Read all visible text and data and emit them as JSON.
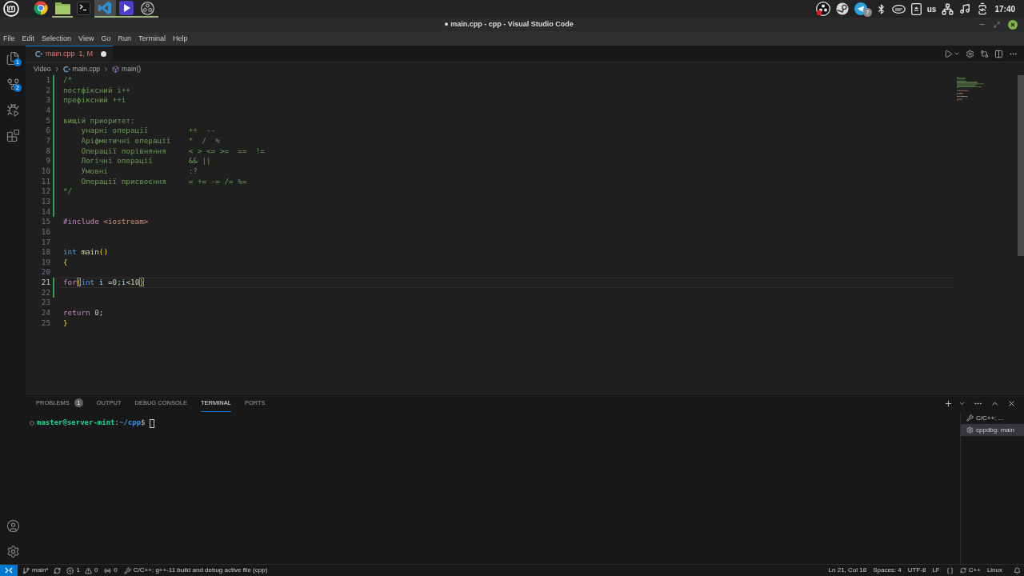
{
  "taskbar": {
    "apps": [
      {
        "kind": "browser",
        "running": false,
        "selected": false
      },
      {
        "kind": "files",
        "running": true,
        "selected": false
      },
      {
        "kind": "terminal",
        "running": false,
        "selected": false
      },
      {
        "kind": "code",
        "running": true,
        "selected": true
      },
      {
        "kind": "player",
        "running": true,
        "selected": false
      },
      {
        "kind": "recorder",
        "running": true,
        "selected": false
      }
    ],
    "tray": {
      "badge": "7",
      "keyboard_layout": "us",
      "clock": "17:40"
    }
  },
  "window": {
    "title": "● main.cpp - cpp - Visual Studio Code"
  },
  "menu": [
    "File",
    "Edit",
    "Selection",
    "View",
    "Go",
    "Run",
    "Terminal",
    "Help"
  ],
  "activity_bar": {
    "explorer_badge": "1",
    "source_control_badge": "2"
  },
  "tabs": [
    {
      "label": "main.cpp",
      "status": "1, M",
      "dirty": true,
      "selected": true
    }
  ],
  "breadcrumb": {
    "folder": "Video",
    "file": "main.cpp",
    "symbol": "main()"
  },
  "editor": {
    "lines": [
      {
        "number": "1",
        "added": true,
        "current": false,
        "tokens": [
          {
            "kind": "comment",
            "text": "/*"
          }
        ]
      },
      {
        "number": "2",
        "added": true,
        "current": false,
        "tokens": [
          {
            "kind": "comment",
            "text": "постфіксний i++"
          }
        ]
      },
      {
        "number": "3",
        "added": true,
        "current": false,
        "tokens": [
          {
            "kind": "comment",
            "text": "префіксний ++i"
          }
        ]
      },
      {
        "number": "4",
        "added": true,
        "current": false
      },
      {
        "number": "5",
        "added": true,
        "current": false,
        "tokens": [
          {
            "kind": "comment",
            "text": "вищій приоритет:"
          }
        ]
      },
      {
        "number": "6",
        "added": true,
        "current": false,
        "tokens": [
          {
            "kind": "comment",
            "text": "    унарні операції         ++  --"
          }
        ]
      },
      {
        "number": "7",
        "added": true,
        "current": false,
        "tokens": [
          {
            "kind": "comment",
            "text": "    Аріфметичні операції    *  /  %"
          }
        ]
      },
      {
        "number": "8",
        "added": true,
        "current": false,
        "tokens": [
          {
            "kind": "comment",
            "text": "    Операції порівняння     < > <= >=  ==  !="
          }
        ]
      },
      {
        "number": "9",
        "added": true,
        "current": false,
        "tokens": [
          {
            "kind": "comment",
            "text": "    Логічні операції        && ||"
          }
        ]
      },
      {
        "number": "10",
        "added": true,
        "current": false,
        "tokens": [
          {
            "kind": "comment",
            "text": "    Умовні                  :?"
          }
        ]
      },
      {
        "number": "11",
        "added": true,
        "current": false,
        "tokens": [
          {
            "kind": "comment",
            "text": "    Операції присвоєння     = += -= /= %="
          }
        ]
      },
      {
        "number": "12",
        "added": true,
        "current": false,
        "tokens": [
          {
            "kind": "comment",
            "text": "*/"
          }
        ]
      },
      {
        "number": "13",
        "added": true,
        "current": false
      },
      {
        "number": "14",
        "added": true,
        "current": false
      },
      {
        "number": "15",
        "added": false,
        "current": false,
        "tokens": [
          {
            "kind": "keyword",
            "text": "#include "
          },
          {
            "kind": "string",
            "text": "<iostream>"
          }
        ]
      },
      {
        "number": "16",
        "added": false,
        "current": false
      },
      {
        "number": "17",
        "added": false,
        "current": false
      },
      {
        "number": "18",
        "added": false,
        "current": false,
        "tokens": [
          {
            "kind": "type",
            "text": "int "
          },
          {
            "kind": "function",
            "text": "main"
          },
          {
            "kind": "bracket",
            "text": "()"
          }
        ]
      },
      {
        "number": "19",
        "added": false,
        "current": false,
        "tokens": [
          {
            "kind": "bracket",
            "text": "{"
          }
        ]
      },
      {
        "number": "20",
        "added": false,
        "current": false
      },
      {
        "number": "21",
        "added": true,
        "current": true,
        "tokens": [
          {
            "kind": "keyword",
            "text": "for"
          },
          {
            "kind": "bracket_match",
            "text": "("
          },
          {
            "kind": "type",
            "text": "int "
          },
          {
            "kind": "variable",
            "text": "i"
          },
          {
            "kind": "plain",
            "text": " ="
          },
          {
            "kind": "number",
            "text": "0"
          },
          {
            "kind": "plain",
            "text": ";"
          },
          {
            "kind": "variable",
            "text": "i"
          },
          {
            "kind": "plain",
            "text": "<"
          },
          {
            "kind": "number",
            "text": "10"
          },
          {
            "kind": "bracket_match",
            "text": ")"
          }
        ]
      },
      {
        "number": "22",
        "added": true,
        "current": false
      },
      {
        "number": "23",
        "added": false,
        "current": false
      },
      {
        "number": "24",
        "added": false,
        "current": false,
        "tokens": [
          {
            "kind": "keyword",
            "text": "return "
          },
          {
            "kind": "number",
            "text": "0"
          },
          {
            "kind": "plain",
            "text": ";"
          }
        ]
      },
      {
        "number": "25",
        "added": false,
        "current": false,
        "tokens": [
          {
            "kind": "bracket",
            "text": "}"
          }
        ]
      }
    ]
  },
  "panel": {
    "tabs": [
      {
        "label": "PROBLEMS",
        "badge": "1",
        "selected": false
      },
      {
        "label": "OUTPUT",
        "selected": false
      },
      {
        "label": "DEBUG CONSOLE",
        "selected": false
      },
      {
        "label": "TERMINAL",
        "selected": true
      },
      {
        "label": "PORTS",
        "selected": false
      }
    ],
    "terminal": {
      "prompt": [
        {
          "kind": "user",
          "text": "master@server-mint"
        },
        {
          "kind": "plain",
          "text": ":"
        },
        {
          "kind": "path",
          "text": "~/cpp"
        },
        {
          "kind": "plain",
          "text": "$"
        }
      ]
    },
    "terminals": [
      {
        "kind": "task",
        "label": "C/C++: ...",
        "selected": false
      },
      {
        "kind": "debug",
        "label": "cppdbg: main",
        "selected": true
      }
    ]
  },
  "status_bar": {
    "branch": "main*",
    "errors": "1",
    "warnings": "0",
    "ports": "0",
    "task": "C/C++: g++-11 build and debug active file (cpp)",
    "cursor_position": "Ln 21, Col 18",
    "indentation": "Spaces: 4",
    "encoding": "UTF-8",
    "line_ending": "LF",
    "language": "C++",
    "platform": "Linux"
  }
}
